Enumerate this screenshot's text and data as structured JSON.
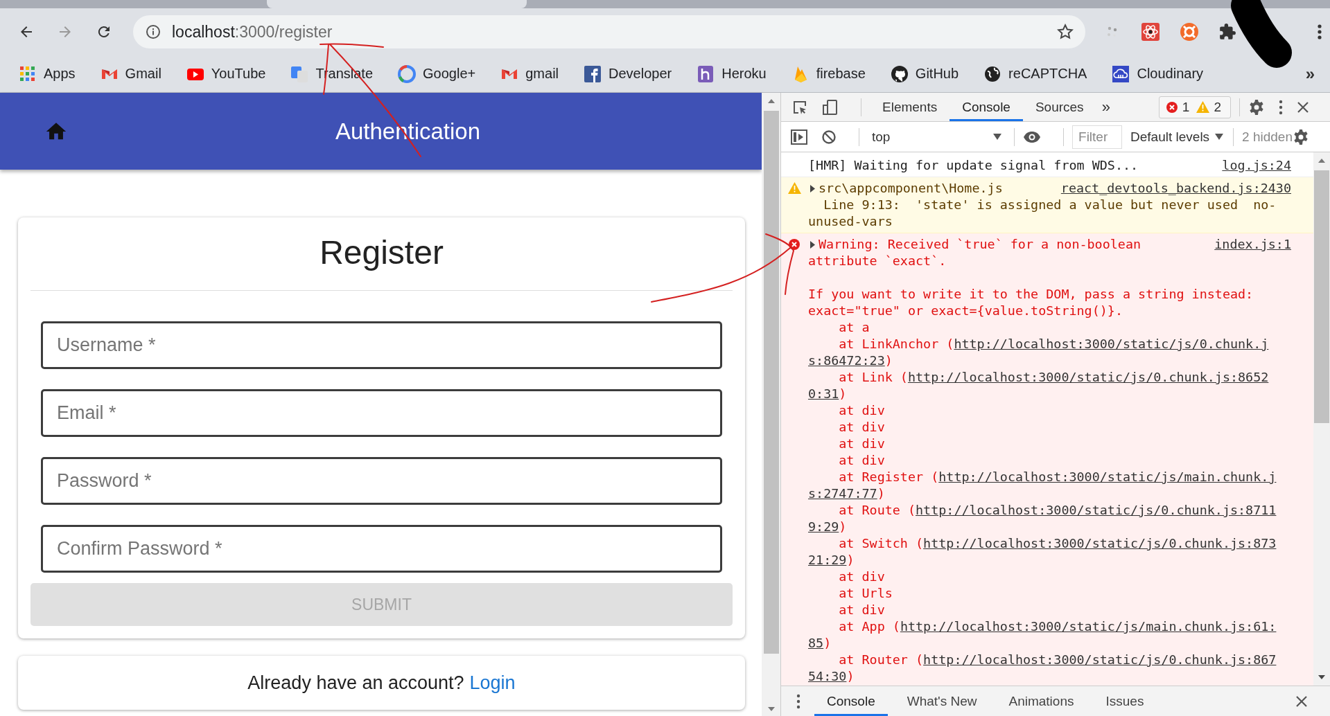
{
  "browser": {
    "url_host": "localhost",
    "url_path": ":3000/register",
    "bookmarks": [
      {
        "label": "Apps"
      },
      {
        "label": "Gmail"
      },
      {
        "label": "YouTube"
      },
      {
        "label": "Translate"
      },
      {
        "label": "Google+"
      },
      {
        "label": "gmail"
      },
      {
        "label": "Developer"
      },
      {
        "label": "Heroku"
      },
      {
        "label": "firebase"
      },
      {
        "label": "GitHub"
      },
      {
        "label": "reCAPTCHA"
      },
      {
        "label": "Cloudinary"
      }
    ],
    "more_bookmarks": "»"
  },
  "app": {
    "title": "Authentication",
    "card_title": "Register",
    "fields": [
      {
        "placeholder": "Username *"
      },
      {
        "placeholder": "Email *"
      },
      {
        "placeholder": "Password *"
      },
      {
        "placeholder": "Confirm Password *"
      }
    ],
    "submit": {
      "label": "SUBMIT",
      "disabled": true
    },
    "login_prompt": "Already have an account?",
    "login_link": "Login"
  },
  "devtools": {
    "tabs": [
      {
        "label": "Elements",
        "selected": false
      },
      {
        "label": "Console",
        "selected": true
      },
      {
        "label": "Sources",
        "selected": false
      }
    ],
    "more_tabs": "»",
    "error_count": "1",
    "warning_count": "2",
    "context": "top",
    "filter": {
      "placeholder": "Filter"
    },
    "levels": "Default levels",
    "hidden": "2 hidden",
    "messages": [
      {
        "kind": "info",
        "source": "log.js:24",
        "paragraphs": [
          [
            {
              "text": "[HMR] Waiting for update signal from WDS..."
            }
          ]
        ]
      },
      {
        "kind": "warning",
        "expanded": false,
        "source": "react_devtools_backend.js:2430",
        "paragraphs": [
          [
            {
              "text": "src\\appcomponent\\Home.js"
            },
            {
              "text": "  Line 9:13:  'state' is assigned a value but never used  no-"
            },
            {
              "text": "unused-vars"
            }
          ]
        ]
      },
      {
        "kind": "error",
        "expanded": false,
        "source": "index.js:1",
        "paragraphs": [
          [
            {
              "text": "Warning: Received `true` for a non-boolean"
            },
            {
              "text": "attribute `exact`."
            }
          ],
          [
            {
              "text": "If you want to write it to the DOM, pass a string instead:"
            },
            {
              "text": "exact=\"true\" or exact={value.toString()}."
            },
            {
              "text": "    at a"
            },
            {
              "text": "    at LinkAnchor (",
              "link": "http://localhost:3000/static/js/0.chunk.j"
            },
            {
              "link": "s:86472:23",
              "after": ")"
            },
            {
              "text": "    at Link (",
              "link": "http://localhost:3000/static/js/0.chunk.js:8652"
            },
            {
              "link": "0:31",
              "after": ")"
            },
            {
              "text": "    at div"
            },
            {
              "text": "    at div"
            },
            {
              "text": "    at div"
            },
            {
              "text": "    at div"
            },
            {
              "text": "    at Register (",
              "link": "http://localhost:3000/static/js/main.chunk.j"
            },
            {
              "link": "s:2747:77",
              "after": ")"
            },
            {
              "text": "    at Route (",
              "link": "http://localhost:3000/static/js/0.chunk.js:8711"
            },
            {
              "link": "9:29",
              "after": ")"
            },
            {
              "text": "    at Switch (",
              "link": "http://localhost:3000/static/js/0.chunk.js:873"
            },
            {
              "link": "21:29",
              "after": ")"
            },
            {
              "text": "    at div"
            },
            {
              "text": "    at Urls"
            },
            {
              "text": "    at div"
            },
            {
              "text": "    at App (",
              "link": "http://localhost:3000/static/js/main.chunk.js:61:"
            },
            {
              "link": "85",
              "after": ")"
            },
            {
              "text": "    at Router (",
              "link": "http://localhost:3000/static/js/0.chunk.js:867"
            },
            {
              "link": "54:30",
              "after": ")"
            }
          ]
        ]
      }
    ],
    "drawer_tabs": [
      {
        "label": "Console",
        "selected": true
      },
      {
        "label": "What's New",
        "selected": false
      },
      {
        "label": "Animations",
        "selected": false
      },
      {
        "label": "Issues",
        "selected": false
      }
    ]
  }
}
